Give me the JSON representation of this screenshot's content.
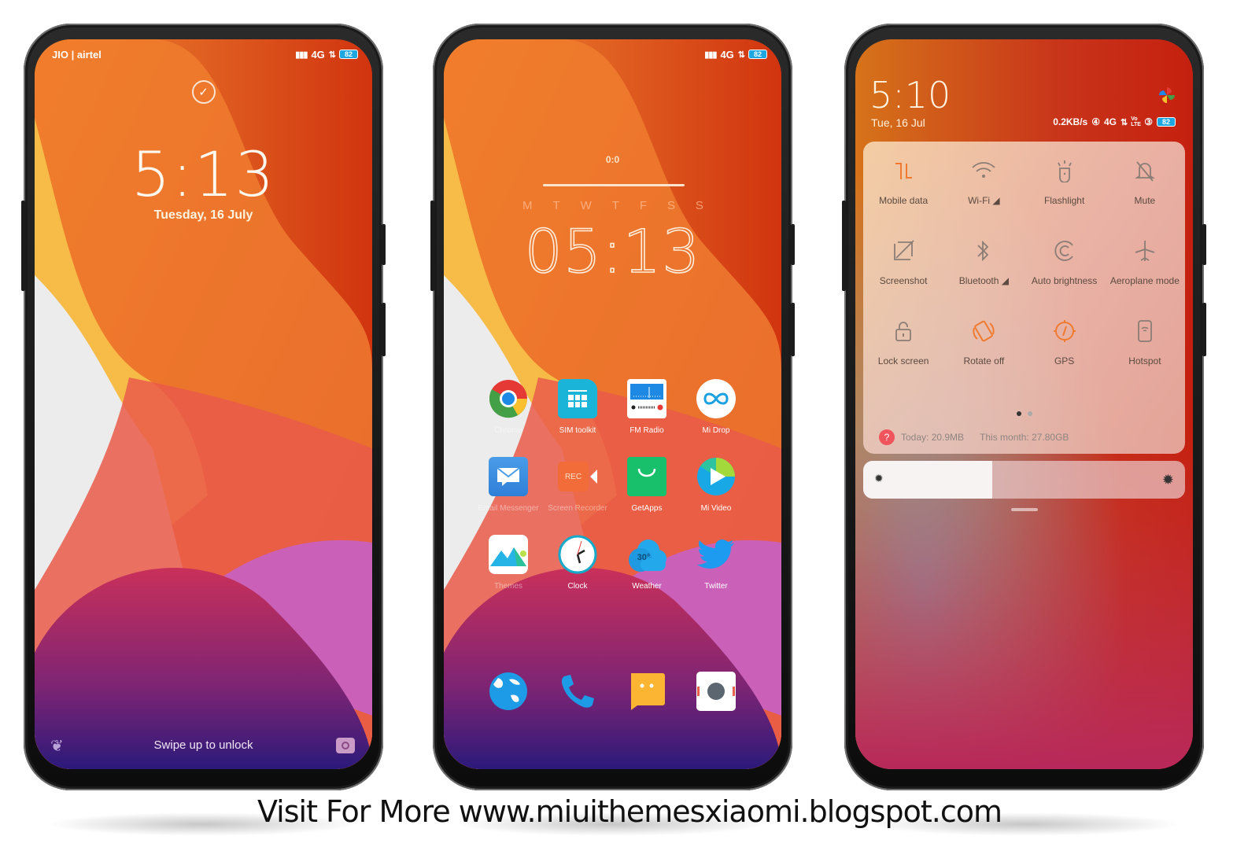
{
  "colors": {
    "wallpaper_orange": "#ef7a2c",
    "wallpaper_red": "#d63014",
    "wallpaper_yellow": "#f6c34a",
    "wallpaper_purple": "#8d2c7a",
    "accent_orange": "#f07a30",
    "battery_blue": "#1da6e0"
  },
  "lock_screen": {
    "carrier": "JIO | airtel",
    "network": "4G",
    "battery": "82",
    "icon": "check-circle-icon",
    "time": "5:13",
    "date": "Tuesday, 16 July",
    "swipe_text": "Swipe up to unlock",
    "left_shortcut_icon": "tulip-icon",
    "right_shortcut_icon": "camera-icon"
  },
  "home_screen": {
    "network": "4G",
    "battery": "82",
    "widget_counter": "0:0",
    "weekdays": [
      "M",
      "T",
      "W",
      "T",
      "F",
      "S",
      "S"
    ],
    "time": "05:13",
    "apps": [
      {
        "label": "Chrome",
        "icon": "chrome-icon",
        "faint": true
      },
      {
        "label": "SIM toolkit",
        "icon": "sim-toolkit-icon",
        "faint": false
      },
      {
        "label": "FM Radio",
        "icon": "fm-radio-icon",
        "faint": false
      },
      {
        "label": "Mi Drop",
        "icon": "mi-drop-icon",
        "faint": false
      },
      {
        "label": "Email Messenger",
        "icon": "email-icon",
        "faint": true
      },
      {
        "label": "Screen Recorder",
        "icon": "screen-recorder-icon",
        "faint": true
      },
      {
        "label": "GetApps",
        "icon": "getapps-icon",
        "faint": false
      },
      {
        "label": "Mi Video",
        "icon": "mi-video-icon",
        "faint": false
      },
      {
        "label": "Themes",
        "icon": "themes-icon",
        "faint": true
      },
      {
        "label": "Clock",
        "icon": "clock-icon",
        "faint": false
      },
      {
        "label": "Weather",
        "icon": "weather-icon",
        "faint": false
      },
      {
        "label": "Twitter",
        "icon": "twitter-icon",
        "faint": false
      }
    ],
    "weather_temp": "30°",
    "rec_label": "REC",
    "dock": [
      {
        "icon": "browser-globe-icon"
      },
      {
        "icon": "phone-icon"
      },
      {
        "icon": "messages-icon"
      },
      {
        "icon": "camera-icon"
      }
    ]
  },
  "control_center": {
    "time": "5:10",
    "date": "Tue, 16 Jul",
    "net_speed": "0.2KB/s",
    "network": "4G",
    "volte": "Vo LTE",
    "battery": "82",
    "tiles": [
      {
        "label": "Mobile data",
        "icon": "mobile-data-icon",
        "active": true
      },
      {
        "label": "Wi-Fi ◢",
        "icon": "wifi-icon",
        "active": false
      },
      {
        "label": "Flashlight",
        "icon": "flashlight-icon",
        "active": false
      },
      {
        "label": "Mute",
        "icon": "mute-bell-icon",
        "active": false
      },
      {
        "label": "Screenshot",
        "icon": "screenshot-icon",
        "active": false
      },
      {
        "label": "Bluetooth ◢",
        "icon": "bluetooth-icon",
        "active": false
      },
      {
        "label": "Auto brightness",
        "icon": "auto-brightness-icon",
        "active": false
      },
      {
        "label": "Aeroplane mode",
        "icon": "aeroplane-icon",
        "active": false
      },
      {
        "label": "Lock screen",
        "icon": "lock-icon",
        "active": false
      },
      {
        "label": "Rotate off",
        "icon": "rotate-icon",
        "active": true
      },
      {
        "label": "GPS",
        "icon": "gps-icon",
        "active": true
      },
      {
        "label": "Hotspot",
        "icon": "hotspot-icon",
        "active": false
      }
    ],
    "page_indicator": {
      "current": 1,
      "total": 2
    },
    "usage_badge": "?",
    "usage_today": "Today: 20.9MB",
    "usage_month": "This month: 27.80GB",
    "brightness_level": 0.4
  },
  "footer": {
    "text": "Visit For More www.miuithemesxiaomi.blogspot.com"
  }
}
